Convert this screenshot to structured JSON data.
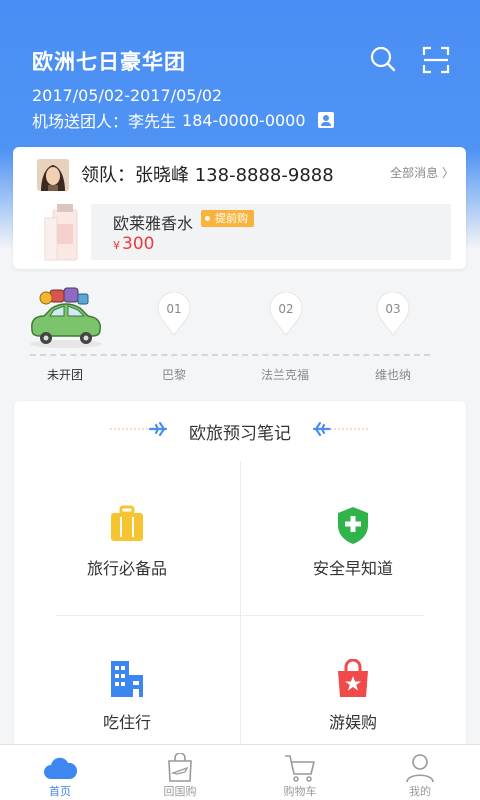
{
  "header": {
    "title": "欧洲七日豪华团",
    "dates": "2017/05/02-2017/05/02",
    "guide_label": "机场送团人：李先生",
    "guide_phone": "184-0000-0000",
    "icons": [
      "search-icon",
      "scan-icon",
      "contact-card-icon"
    ]
  },
  "leader": {
    "label": "领队：张晓峰 138-8888-9888",
    "all_messages": "全部消息 〉",
    "product": {
      "name": "欧莱雅香水",
      "tag": "提前购",
      "currency": "¥",
      "price": "300"
    }
  },
  "route": {
    "stops": [
      {
        "num": "",
        "label": "未开团"
      },
      {
        "num": "01",
        "label": "巴黎"
      },
      {
        "num": "02",
        "label": "法兰克福"
      },
      {
        "num": "03",
        "label": "维也纳"
      }
    ]
  },
  "notes": {
    "title": "欧旅预习笔记",
    "items": [
      {
        "label": "旅行必备品",
        "icon": "luggage-icon"
      },
      {
        "label": "安全早知道",
        "icon": "shield-icon"
      },
      {
        "label": "吃住行",
        "icon": "building-icon"
      },
      {
        "label": "游娱购",
        "icon": "shopping-bag-icon"
      }
    ]
  },
  "nav": {
    "items": [
      {
        "label": "首页",
        "icon": "cloud-icon",
        "active": true
      },
      {
        "label": "回国购",
        "icon": "bag-plane-icon"
      },
      {
        "label": "购物车",
        "icon": "cart-icon"
      },
      {
        "label": "我的",
        "icon": "user-icon"
      }
    ]
  },
  "colors": {
    "primary": "#4a8ef5",
    "price": "#ef3a3a",
    "tag": "#f9b23b",
    "luggage": "#f6c431",
    "shield": "#2fb34a",
    "building": "#3b86f0",
    "bag": "#f04a4a"
  }
}
